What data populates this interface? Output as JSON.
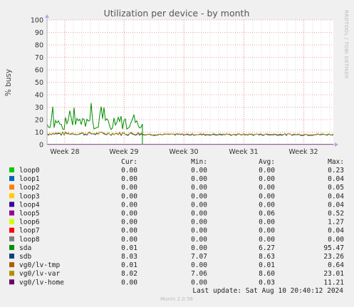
{
  "chart_data": {
    "type": "line",
    "title": "Utilization per device - by month",
    "ylabel": "% busy",
    "ylim": [
      0,
      100
    ],
    "yticks": [
      0,
      10,
      20,
      30,
      40,
      50,
      60,
      70,
      80,
      90,
      100
    ],
    "x_tick_labels": [
      "Week 28",
      "Week 29",
      "Week 30",
      "Week 31",
      "Week 32"
    ],
    "grid": true,
    "watermark": "RRDTOOL / TOBI OETIKER",
    "colors": {
      "background": "#f0f0f0",
      "plot_background": "#ffffff",
      "grid_minor": "#e6e6e6",
      "grid_major": "#f2a0a0",
      "axis": "#bbbbbb"
    },
    "legend_headers": {
      "cur": "Cur:",
      "min": "Min:",
      "avg": "Avg:",
      "max": "Max:"
    },
    "series": [
      {
        "name": "loop0",
        "color": "#00cc00",
        "cur": "0.00",
        "min": "0.00",
        "avg": "0.00",
        "max": "0.23"
      },
      {
        "name": "loop1",
        "color": "#0066b3",
        "cur": "0.00",
        "min": "0.00",
        "avg": "0.00",
        "max": "0.04"
      },
      {
        "name": "loop2",
        "color": "#ff8000",
        "cur": "0.00",
        "min": "0.00",
        "avg": "0.00",
        "max": "0.05"
      },
      {
        "name": "loop3",
        "color": "#ffcc00",
        "cur": "0.00",
        "min": "0.00",
        "avg": "0.00",
        "max": "0.04"
      },
      {
        "name": "loop4",
        "color": "#330099",
        "cur": "0.00",
        "min": "0.00",
        "avg": "0.00",
        "max": "0.04"
      },
      {
        "name": "loop5",
        "color": "#990099",
        "cur": "0.00",
        "min": "0.00",
        "avg": "0.06",
        "max": "0.52"
      },
      {
        "name": "loop6",
        "color": "#ccff00",
        "cur": "0.00",
        "min": "0.00",
        "avg": "0.00",
        "max": "1.27"
      },
      {
        "name": "loop7",
        "color": "#ff0000",
        "cur": "0.00",
        "min": "0.00",
        "avg": "0.00",
        "max": "0.04"
      },
      {
        "name": "loop8",
        "color": "#808080",
        "cur": "0.00",
        "min": "0.00",
        "avg": "0.00",
        "max": "0.00"
      },
      {
        "name": "sda",
        "color": "#008f00",
        "cur": "0.01",
        "min": "0.00",
        "avg": "6.27",
        "max": "95.47"
      },
      {
        "name": "sdb",
        "color": "#00487d",
        "cur": "8.03",
        "min": "7.07",
        "avg": "8.63",
        "max": "23.26"
      },
      {
        "name": "vg0/lv-tmp",
        "color": "#b35a00",
        "cur": "0.01",
        "min": "0.00",
        "avg": "0.01",
        "max": "0.64"
      },
      {
        "name": "vg0/lv-var",
        "color": "#b38f00",
        "cur": "8.02",
        "min": "7.06",
        "avg": "8.60",
        "max": "23.01"
      },
      {
        "name": "vg0/lv-home",
        "color": "#6b006b",
        "cur": "0.00",
        "min": "0.00",
        "avg": "0.03",
        "max": "11.21"
      }
    ],
    "last_update": "Last update: Sat Aug 10 20:40:12 2024",
    "footer": "Munin 2.0.56"
  }
}
